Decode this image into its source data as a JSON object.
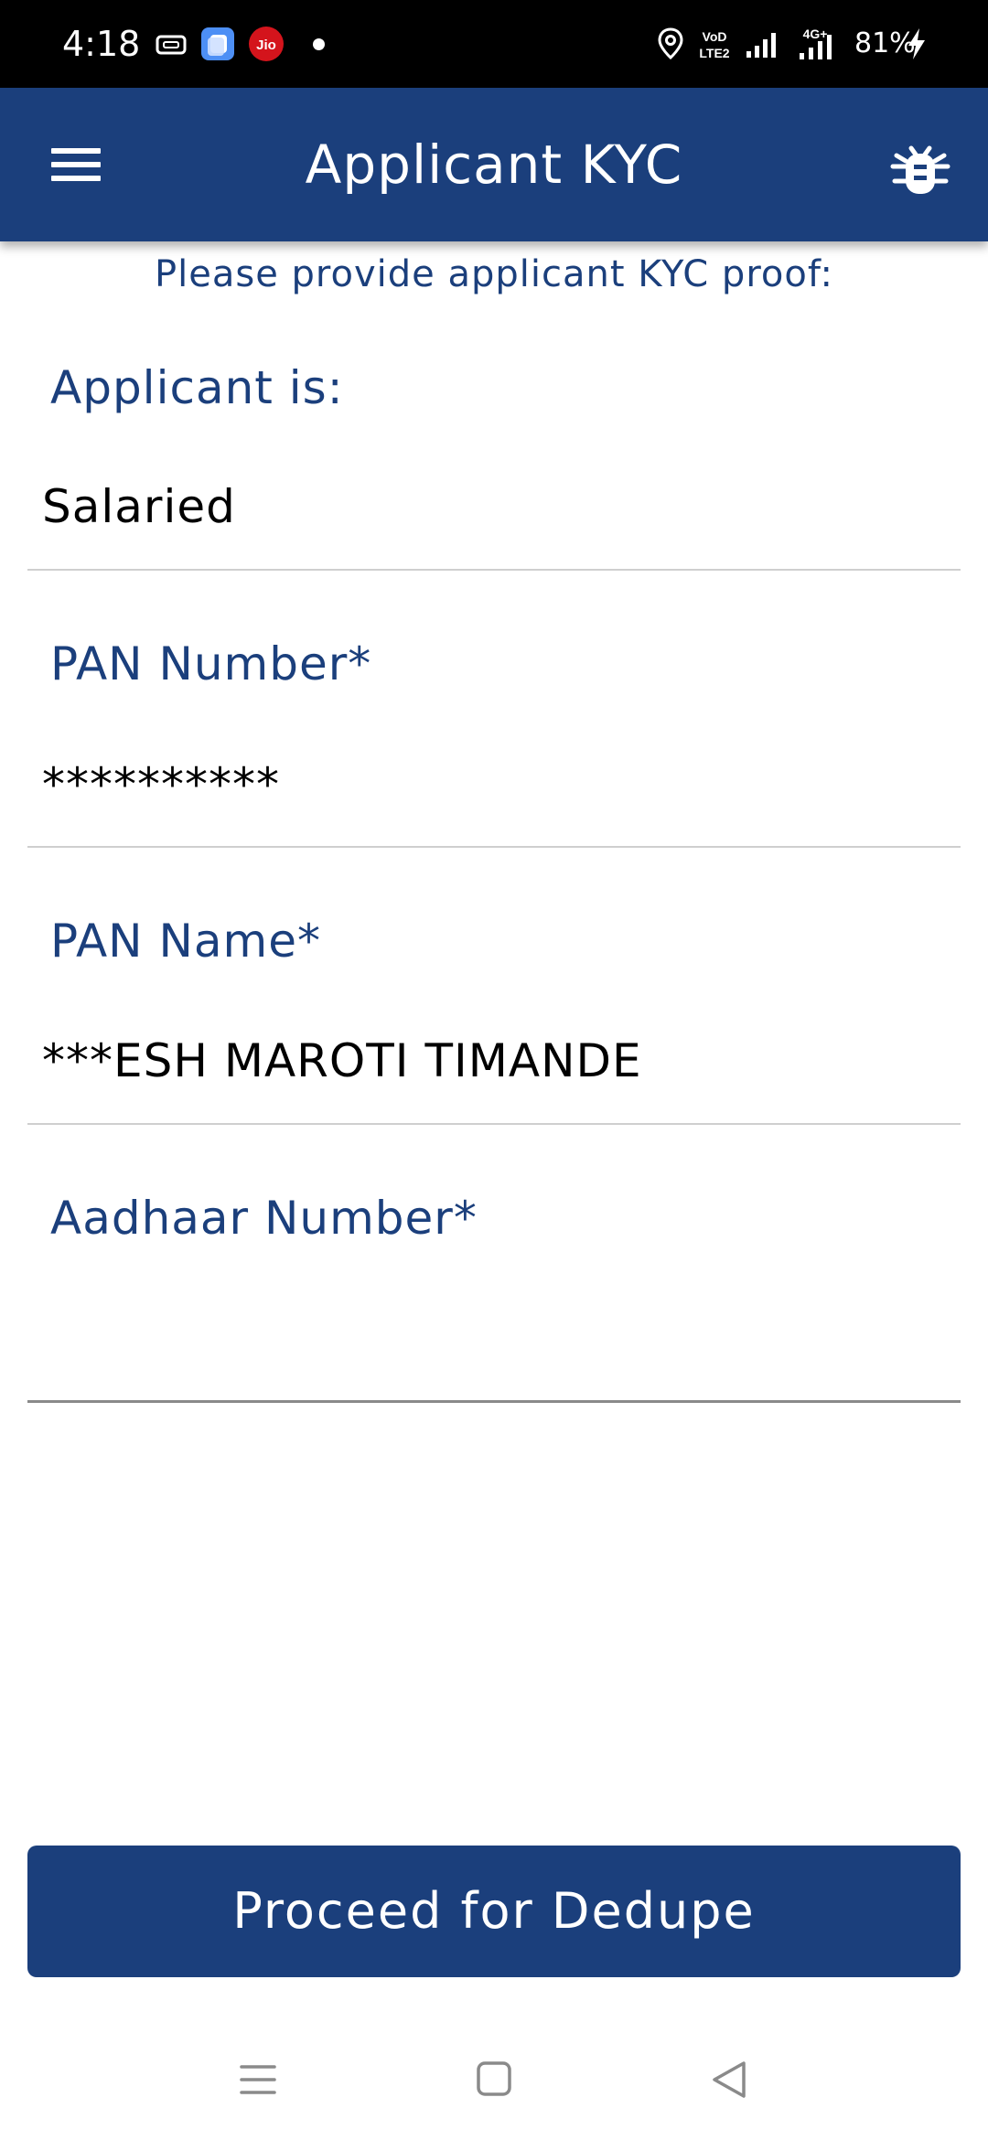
{
  "status_bar": {
    "time": "4:18",
    "battery": "81%",
    "icons": [
      "screen-record-icon",
      "app-notification-icon",
      "jio-icon",
      "location-icon",
      "volte-icon",
      "signal-icon",
      "signal-4g-icon",
      "charging-icon"
    ],
    "jio_label": "Jio",
    "volte_label_top": "VoD",
    "volte_label_bottom": "LTE2",
    "network_label": "4G+"
  },
  "app_bar": {
    "title": "Applicant KYC",
    "menu_icon": "hamburger-menu-icon",
    "action_icon": "bug-icon"
  },
  "form": {
    "subtitle": "Please provide applicant KYC proof:",
    "applicant_type": {
      "label": "Applicant is:",
      "value": "Salaried"
    },
    "pan_number": {
      "label": "PAN Number*",
      "value": "**********"
    },
    "pan_name": {
      "label": "PAN Name*",
      "value": "***ESH MAROTI TIMANDE"
    },
    "aadhaar_number": {
      "label": "Aadhaar Number*",
      "value": ""
    }
  },
  "proceed_button": {
    "label": "Proceed for Dedupe"
  },
  "nav_bar": {
    "items": [
      "recents-icon",
      "home-icon",
      "back-icon"
    ]
  },
  "colors": {
    "primary": "#1b3f7c",
    "status_bar": "#000000",
    "background": "#ffffff",
    "divider": "#cfcfcf"
  }
}
